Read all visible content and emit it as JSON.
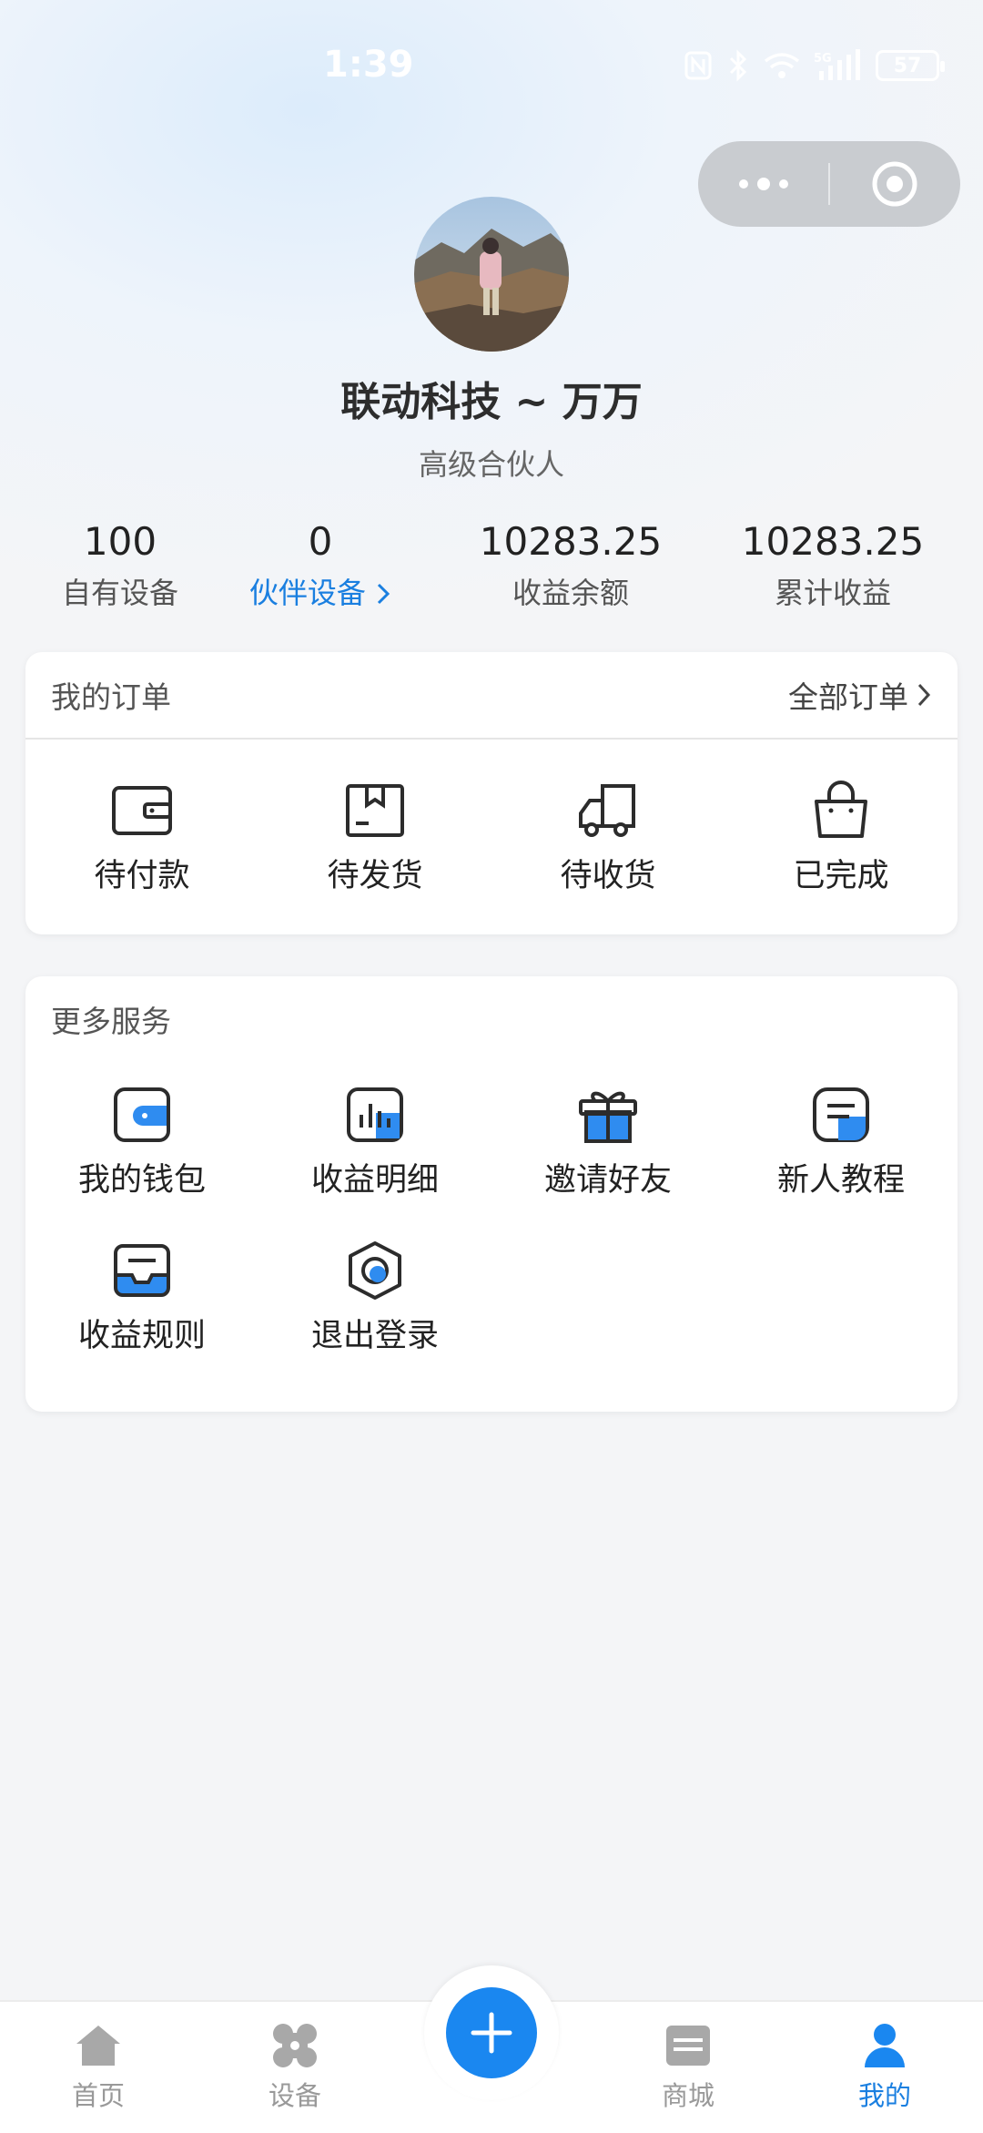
{
  "status_bar": {
    "time": "1:39",
    "battery": "57"
  },
  "profile": {
    "name": "联动科技 ~ 万万",
    "level": "高级合伙人"
  },
  "stats": [
    {
      "value": "100",
      "label": "自有设备"
    },
    {
      "value": "0",
      "label": "伙伴设备"
    },
    {
      "value": "10283.25",
      "label": "收益余额"
    },
    {
      "value": "10283.25",
      "label": "累计收益"
    }
  ],
  "orders": {
    "title": "我的订单",
    "all_label": "全部订单",
    "items": [
      {
        "label": "待付款",
        "icon": "wallet-icon"
      },
      {
        "label": "待发货",
        "icon": "package-icon"
      },
      {
        "label": "待收货",
        "icon": "truck-icon"
      },
      {
        "label": "已完成",
        "icon": "shopping-bag-icon"
      }
    ]
  },
  "services": {
    "title": "更多服务",
    "items": [
      {
        "label": "我的钱包",
        "icon": "wallet-icon"
      },
      {
        "label": "收益明细",
        "icon": "bar-chart-icon"
      },
      {
        "label": "邀请好友",
        "icon": "gift-icon"
      },
      {
        "label": "新人教程",
        "icon": "document-icon"
      },
      {
        "label": "收益规则",
        "icon": "inbox-icon"
      },
      {
        "label": "退出登录",
        "icon": "logout-icon"
      }
    ]
  },
  "tabbar": {
    "items": [
      {
        "label": "首页",
        "icon": "home-icon"
      },
      {
        "label": "设备",
        "icon": "devices-icon"
      },
      {
        "label": "商城",
        "icon": "store-icon"
      },
      {
        "label": "我的",
        "icon": "person-icon",
        "active": true
      }
    ],
    "center_icon": "plus-icon"
  },
  "colors": {
    "accent": "#1a87f0",
    "link": "#1a7fe0"
  }
}
